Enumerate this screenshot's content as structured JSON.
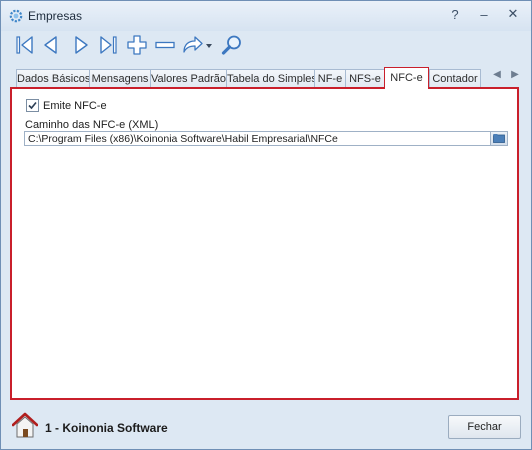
{
  "window": {
    "title": "Empresas"
  },
  "title_buttons": {
    "help": "?",
    "minimize": "–",
    "close": "✕"
  },
  "toolbar": {
    "icons": [
      "first-record-icon",
      "previous-record-icon",
      "next-record-icon",
      "last-record-icon",
      "add-icon",
      "remove-icon",
      "redo-icon",
      "dropdown-arrow-icon",
      "search-icon"
    ]
  },
  "tabs": [
    {
      "label": "Dados Básicos"
    },
    {
      "label": "Mensagens"
    },
    {
      "label": "Valores Padrão"
    },
    {
      "label": "Tabela do Simples"
    },
    {
      "label": "NF-e"
    },
    {
      "label": "NFS-e"
    },
    {
      "label": "NFC-e"
    },
    {
      "label": "Contador"
    }
  ],
  "active_tab": "NFC-e",
  "nfce": {
    "emit_label": "Emite NFC-e",
    "emit_checked": true,
    "path_label": "Caminho das NFC-e (XML)",
    "path_value": "C:\\Program Files (x86)\\Koinonia Software\\Habil Empresarial\\NFCe"
  },
  "footer": {
    "company": "1 - Koinonia Software",
    "close_label": "Fechar"
  },
  "colors": {
    "active_border": "#c91f2b",
    "frame": "#dde8f3"
  }
}
